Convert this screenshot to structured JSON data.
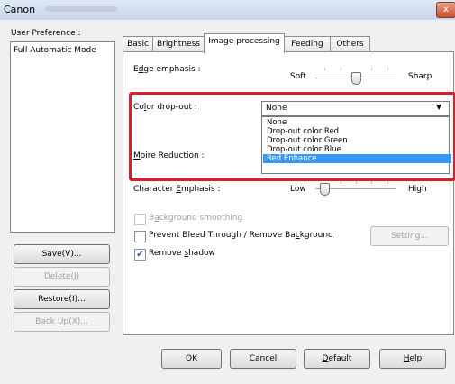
{
  "window": {
    "title": "Canon",
    "close_glyph": "x"
  },
  "sidebar": {
    "preference_label": "User Preference :",
    "list_items": [
      "Full Automatic Mode"
    ],
    "buttons": {
      "save": "Save(V)...",
      "delete": "Delete(J)",
      "restore": "Restore(I)...",
      "backup": "Back Up(X)..."
    }
  },
  "tabs": [
    {
      "label": "Basic"
    },
    {
      "label": "Brightness"
    },
    {
      "label": "Image processing",
      "active": true
    },
    {
      "label": "Feeding"
    },
    {
      "label": "Others"
    }
  ],
  "panel": {
    "edge_emphasis": {
      "label": "Edge emphasis :",
      "min_label": "Soft",
      "max_label": "Sharp",
      "value_fraction": 0.5
    },
    "color_dropout": {
      "label": "Color drop-out :",
      "selected": "None",
      "options": [
        "None",
        "Drop-out color Red",
        "Drop-out color Green",
        "Drop-out color Blue",
        "Red Enhance"
      ],
      "highlighted_option": "Red Enhance"
    },
    "moire_reduction": {
      "label": "Moire Reduction :"
    },
    "character_emphasis": {
      "label": "Character Emphasis :",
      "min_label": "Low",
      "max_label": "High",
      "value_fraction": 0.1
    },
    "background_smoothing": {
      "label": "Background smoothing",
      "checked": false,
      "enabled": false
    },
    "prevent_bleed": {
      "label": "Prevent Bleed Through / Remove Background",
      "checked": false,
      "enabled": true
    },
    "setting_button": "Setting...",
    "remove_shadow": {
      "label": "Remove shadow",
      "checked": true,
      "enabled": true
    }
  },
  "footer": {
    "ok": "OK",
    "cancel": "Cancel",
    "default": "Default",
    "help": "Help"
  },
  "colors": {
    "highlight_border": "#d6202a",
    "selection": "#3399ff"
  }
}
